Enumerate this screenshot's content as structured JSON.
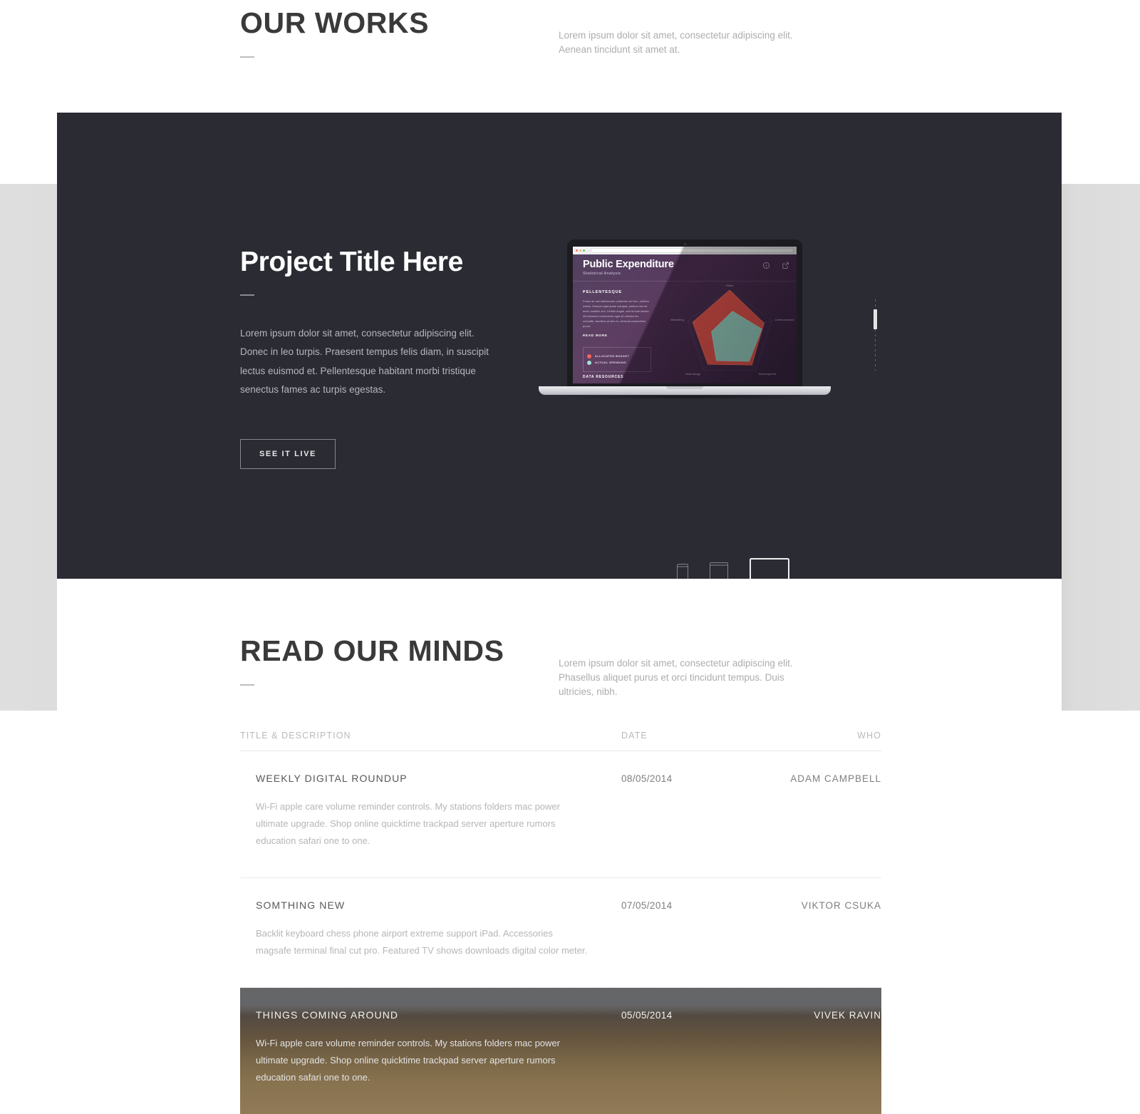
{
  "works_section": {
    "title": "OUR WORKS",
    "lede": "Lorem ipsum dolor sit amet, consectetur adipiscing elit. Aenean tincidunt sit amet at."
  },
  "project": {
    "title": "Project Title Here",
    "description": "Lorem ipsum dolor sit amet, consectetur adipiscing elit. Donec in leo turpis. Praesent tempus felis diam, in suscipit lectus euismod et. Pellentesque habitant morbi tristique senectus fames ac turpis egestas.",
    "cta_label": "SEE IT LIVE",
    "devices": [
      {
        "name": "phone",
        "label": "Phone",
        "active": false
      },
      {
        "name": "tablet",
        "label": "Tablet",
        "active": false
      },
      {
        "name": "laptop",
        "label": "Laptop",
        "active": true
      }
    ]
  },
  "mockup": {
    "dashboard_title": "Public Expenditure",
    "dashboard_subtitle": "Statistical Analysis",
    "sidebar_heading": "PELLENTESQUE",
    "sidebar_body": "Fusce ac nisl ullamcorper, pharetra orci nec, pretium metus. Semper eget quam volutpat, pretium nisi sit amet, facilisis orci. Ut felis augue, sed id nam lacinia elit dolorsed consectetur eget sit ultricies leo convallis, faucibus at sem in, vehicula consectetur purus.",
    "read_more_label": "READ MORE",
    "footer_label": "DATA RESOURCES",
    "legend": [
      {
        "label": "ALLOCATED BUDGET",
        "color": "#f2594f"
      },
      {
        "label": "ACTUAL SPENDING",
        "color": "#9bdfd0"
      }
    ],
    "chart_data": {
      "type": "radar",
      "title": "Public Expenditure",
      "categories": [
        "Sales",
        "Administration",
        "Development",
        "Technology",
        "Marketing"
      ],
      "series": [
        {
          "name": "ALLOCATED BUDGET",
          "color": "#f2594f",
          "values": [
            100,
            82,
            86,
            84,
            88
          ]
        },
        {
          "name": "ACTUAL SPENDING",
          "color": "#9bdfd0",
          "values": [
            62,
            70,
            64,
            62,
            50
          ]
        }
      ],
      "rmax": 100,
      "grid": true,
      "legend_position": "left"
    }
  },
  "minds_section": {
    "title": "READ OUR MINDS",
    "lede": "Lorem ipsum dolor sit amet, consectetur adipiscing elit. Phasellus aliquet purus et orci tincidunt tempus. Duis ultricies, nibh."
  },
  "blog": {
    "columns": [
      "TITLE & DESCRIPTION",
      "DATE",
      "WHO"
    ],
    "rows": [
      {
        "title": "WEEKLY DIGITAL ROUNDUP",
        "date": "08/05/2014",
        "who": "ADAM CAMPBELL",
        "description": "Wi-Fi apple care volume reminder controls. My stations folders mac power ultimate upgrade. Shop online quicktime trackpad server aperture rumors education safari one to one.",
        "featured": false
      },
      {
        "title": "SOMTHING NEW",
        "date": "07/05/2014",
        "who": "VIKTOR CSUKA",
        "description": "Backlit keyboard chess phone airport extreme support iPad. Accessories magsafe terminal final cut pro. Featured TV shows downloads digital color meter.",
        "featured": false
      },
      {
        "title": "THINGS COMING AROUND",
        "date": "05/05/2014",
        "who": "VIVEK RAVIN",
        "description": "Wi-Fi apple care volume reminder controls. My stations folders mac power ultimate upgrade. Shop online quicktime trackpad server aperture rumors education safari one to one.",
        "featured": true
      }
    ]
  },
  "colors": {
    "dark_section": "#2a2b33",
    "page_bg": "#ffffff",
    "backdrop": "#dedede",
    "heading": "#3a3a3a",
    "muted_text": "#b6b6b6"
  }
}
